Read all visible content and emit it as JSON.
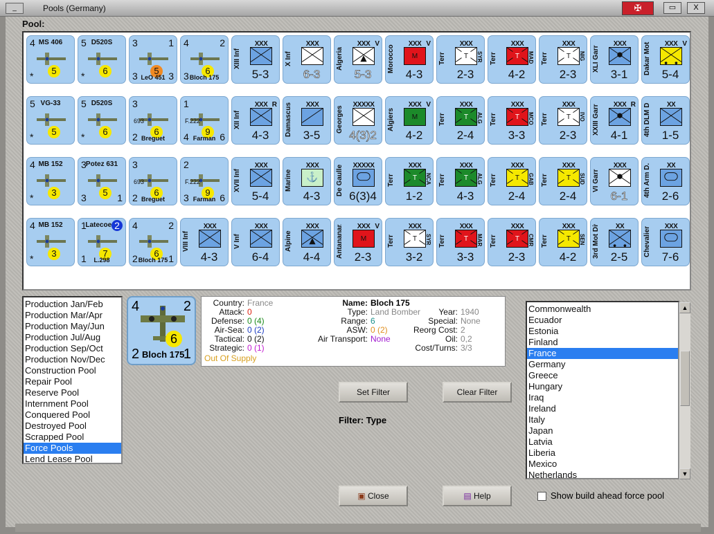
{
  "window": {
    "title": "Pools (Germany)",
    "minimize": "_",
    "close": "X",
    "restore": "▭",
    "flag": "✠"
  },
  "pool_label": "Pool:",
  "counters": [
    {
      "kind": "air",
      "tl": "4",
      "name": "MS 406",
      "circ": "5",
      "bl": "*",
      "col": 0,
      "row": 0
    },
    {
      "kind": "air",
      "tl": "5",
      "name": "D520S",
      "circ": "6",
      "bl": "*",
      "col": 1,
      "row": 0
    },
    {
      "kind": "air",
      "tl": "3",
      "tr": "1",
      "circ": "5",
      "circClass": "orange",
      "bl": "3",
      "br": "3",
      "sub": "LeO 451",
      "col": 2,
      "row": 0
    },
    {
      "kind": "air",
      "tl": "4",
      "tr": "2",
      "circ": "6",
      "bl": "3",
      "br": "",
      "sub": "Bloch 175",
      "col": 3,
      "row": 0
    },
    {
      "kind": "land",
      "label": "XIII Inf",
      "size": "XXX",
      "stat": "5-3",
      "col": 4,
      "row": 0,
      "sym": "inf"
    },
    {
      "kind": "land",
      "label": "X Inf",
      "size": "XXX",
      "stat": "6-3",
      "col": 5,
      "row": 0,
      "sym": "inf",
      "white": true
    },
    {
      "kind": "land",
      "label": "Algeria",
      "size": "XXX",
      "stat": "5-3",
      "col": 6,
      "row": 0,
      "sym": "mtn",
      "white": true,
      "vmark": "V"
    },
    {
      "kind": "land",
      "label": "Morocco",
      "size": "XXX",
      "stat": "4-3",
      "col": 7,
      "row": 0,
      "sym": "M",
      "bg": "#e0141b",
      "vmark": "V"
    },
    {
      "kind": "land",
      "label": "Terr",
      "size": "XXX",
      "stat": "2-3",
      "col": 8,
      "row": 0,
      "sym": "T",
      "bg": "#ffffff",
      "rot": "SYR"
    },
    {
      "kind": "land",
      "label": "Terr",
      "size": "XXX",
      "stat": "4-2",
      "col": 9,
      "row": 0,
      "sym": "T",
      "bg": "#e0141b",
      "rot": "MAD"
    },
    {
      "kind": "land",
      "label": "Terr",
      "size": "XXX",
      "stat": "2-3",
      "col": 10,
      "row": 0,
      "sym": "T",
      "bg": "#ffffff",
      "rot": "NIG"
    },
    {
      "kind": "land",
      "label": "XLI Garr",
      "size": "XXX",
      "stat": "3-1",
      "col": 11,
      "row": 0,
      "sym": "garr"
    },
    {
      "kind": "land",
      "label": "Dakar Mot",
      "size": "XXX",
      "stat": "5-4",
      "col": 12,
      "row": 0,
      "sym": "mot",
      "bg": "#f5e800",
      "vmark": "V"
    },
    {
      "kind": "air",
      "tl": "5",
      "name": "VG-33",
      "circ": "5",
      "bl": "*",
      "col": 0,
      "row": 1
    },
    {
      "kind": "air",
      "tl": "5",
      "name": "D520S",
      "circ": "6",
      "bl": "*",
      "col": 1,
      "row": 1
    },
    {
      "kind": "air",
      "tl": "3",
      "circ": "6",
      "bl": "2",
      "sub": "Breguet",
      "mid": "693",
      "col": 2,
      "row": 1
    },
    {
      "kind": "air",
      "tl": "1",
      "circ": "9",
      "bl": "4",
      "br": "6",
      "sub": "Farman",
      "mid": "F.222",
      "col": 3,
      "row": 1
    },
    {
      "kind": "land",
      "label": "XII Inf",
      "size": "XXX",
      "stat": "4-3",
      "col": 4,
      "row": 1,
      "sym": "inf",
      "vmark": "R"
    },
    {
      "kind": "land",
      "label": "Damascus",
      "size": "XXX",
      "stat": "3-5",
      "col": 5,
      "row": 1,
      "sym": "mtn2"
    },
    {
      "kind": "land",
      "label": "Georges",
      "size": "XXXXX",
      "stat": "4(3)2",
      "col": 6,
      "row": 1,
      "sym": "inf",
      "white": true
    },
    {
      "kind": "land",
      "label": "Algiers",
      "size": "XXX",
      "stat": "4-2",
      "col": 7,
      "row": 1,
      "sym": "M",
      "bg": "#1c8a2a",
      "vmark": "V"
    },
    {
      "kind": "land",
      "label": "Terr",
      "size": "XXX",
      "stat": "2-4",
      "col": 8,
      "row": 1,
      "sym": "T",
      "bg": "#1c8a2a",
      "rot": "ALG"
    },
    {
      "kind": "land",
      "label": "Terr",
      "size": "XXX",
      "stat": "3-3",
      "col": 9,
      "row": 1,
      "sym": "T",
      "bg": "#e0141b",
      "rot": "MCO"
    },
    {
      "kind": "land",
      "label": "Terr",
      "size": "XXX",
      "stat": "2-3",
      "col": 10,
      "row": 1,
      "sym": "T",
      "bg": "#ffffff",
      "rot": "IVO"
    },
    {
      "kind": "land",
      "label": "XXIII Garr",
      "size": "XXX",
      "stat": "4-1",
      "col": 11,
      "row": 1,
      "sym": "garr",
      "vmark": "R"
    },
    {
      "kind": "land",
      "label": "4th DLM D.",
      "size": "XX",
      "stat": "1-5",
      "col": 12,
      "row": 1,
      "sym": "inf"
    },
    {
      "kind": "air",
      "tl": "4",
      "name": "MB 152",
      "circ": "3",
      "bl": "*",
      "col": 0,
      "row": 2
    },
    {
      "kind": "air",
      "tl": "3",
      "name": "Potez 631",
      "circ": "5",
      "bl": "3",
      "br": "1",
      "col": 1,
      "row": 2
    },
    {
      "kind": "air",
      "tl": "3",
      "circ": "6",
      "bl": "2",
      "sub": "Breguet",
      "mid": "693",
      "col": 2,
      "row": 2
    },
    {
      "kind": "air",
      "tl": "2",
      "circ": "9",
      "bl": "3",
      "br": "6",
      "sub": "Farman",
      "mid": "F.222",
      "col": 3,
      "row": 2
    },
    {
      "kind": "land",
      "label": "XVII Inf",
      "size": "XXX",
      "stat": "5-4",
      "col": 4,
      "row": 2,
      "sym": "inf"
    },
    {
      "kind": "land",
      "label": "Marine",
      "size": "XXX",
      "stat": "4-3",
      "col": 5,
      "row": 2,
      "sym": "anchor",
      "bg": "#c9f0c9"
    },
    {
      "kind": "land",
      "label": "De Gaulle",
      "size": "XXXXX",
      "stat": "6(3)4",
      "col": 6,
      "row": 2,
      "sym": "arm"
    },
    {
      "kind": "land",
      "label": "Terr",
      "size": "XXX",
      "stat": "1-2",
      "col": 7,
      "row": 2,
      "sym": "T",
      "bg": "#1c8a2a",
      "rot": "NCA"
    },
    {
      "kind": "land",
      "label": "Terr",
      "size": "XXX",
      "stat": "4-3",
      "col": 8,
      "row": 2,
      "sym": "T",
      "bg": "#1c8a2a",
      "rot": "ALG"
    },
    {
      "kind": "land",
      "label": "Terr",
      "size": "XXX",
      "stat": "2-4",
      "col": 9,
      "row": 2,
      "sym": "T",
      "bg": "#f5e800",
      "rot": "GAB"
    },
    {
      "kind": "land",
      "label": "Terr",
      "size": "XXX",
      "stat": "2-4",
      "col": 10,
      "row": 2,
      "sym": "T",
      "bg": "#f5e800",
      "rot": "SUD"
    },
    {
      "kind": "land",
      "label": "VI Garr",
      "size": "XXX",
      "stat": "6-1",
      "col": 11,
      "row": 2,
      "sym": "garr",
      "white": true
    },
    {
      "kind": "land",
      "label": "4th Arm D.",
      "size": "XX",
      "stat": "2-6",
      "col": 12,
      "row": 2,
      "sym": "arm"
    },
    {
      "kind": "air",
      "tl": "4",
      "name": "MB 152",
      "circ": "3",
      "bl": "*",
      "col": 0,
      "row": 3
    },
    {
      "kind": "air",
      "tl": "1",
      "name": "Latecoere",
      "circ": "7",
      "bl": "1",
      "sub": "L.298",
      "tr": "2",
      "trBlue": true,
      "col": 1,
      "row": 3
    },
    {
      "kind": "air",
      "tl": "4",
      "tr": "2",
      "circ": "6",
      "bl": "2",
      "br": "1",
      "sub": "Bloch 175",
      "col": 2,
      "row": 3
    },
    {
      "kind": "land",
      "label": "VIII Inf",
      "size": "XXX",
      "stat": "4-3",
      "col": 3,
      "row": 3,
      "sym": "inf"
    },
    {
      "kind": "land",
      "label": "V Inf",
      "size": "XXX",
      "stat": "6-4",
      "col": 4,
      "row": 3,
      "sym": "inf"
    },
    {
      "kind": "land",
      "label": "Alpine",
      "size": "XXX",
      "stat": "4-4",
      "col": 5,
      "row": 3,
      "sym": "mtn"
    },
    {
      "kind": "land",
      "label": "Antananar.",
      "size": "XXX",
      "stat": "2-3",
      "col": 6,
      "row": 3,
      "sym": "M",
      "bg": "#e0141b",
      "vmark": "V"
    },
    {
      "kind": "land",
      "label": "Terr",
      "size": "XXX",
      "stat": "3-2",
      "col": 7,
      "row": 3,
      "sym": "T",
      "bg": "#ffffff",
      "rot": "SYR"
    },
    {
      "kind": "land",
      "label": "Terr",
      "size": "XXX",
      "stat": "3-3",
      "col": 8,
      "row": 3,
      "sym": "T",
      "bg": "#e0141b",
      "rot": "MAR"
    },
    {
      "kind": "land",
      "label": "Terr",
      "size": "XXX",
      "stat": "2-3",
      "col": 9,
      "row": 3,
      "sym": "T",
      "bg": "#e0141b",
      "rot": "CMR"
    },
    {
      "kind": "land",
      "label": "Terr",
      "size": "XXX",
      "stat": "4-2",
      "col": 10,
      "row": 3,
      "sym": "T",
      "bg": "#f5e800",
      "rot": "SEN"
    },
    {
      "kind": "land",
      "label": "3rd Mot Div",
      "size": "XX",
      "stat": "2-5",
      "col": 11,
      "row": 3,
      "sym": "mot"
    },
    {
      "kind": "land",
      "label": "Chevalier",
      "size": "XXX",
      "stat": "7-6",
      "col": 12,
      "row": 3,
      "sym": "arm"
    }
  ],
  "pool_list": {
    "items": [
      "Production Jan/Feb",
      "Production Mar/Apr",
      "Production May/Jun",
      "Production Jul/Aug",
      "Production Sep/Oct",
      "Production Nov/Dec",
      "Construction Pool",
      "Repair Pool",
      "Reserve Pool",
      "Internment Pool",
      "Conquered Pool",
      "Destroyed Pool",
      "Scrapped Pool",
      "Force Pools",
      "Lend Lease Pool"
    ],
    "selected": "Force Pools"
  },
  "preview": {
    "tl": "4",
    "tr": "2",
    "bl": "2",
    "br": "1",
    "circ": "6",
    "sub": "Bloch 175"
  },
  "info": {
    "country_label": "Country:",
    "country": "France",
    "attack_label": "Attack:",
    "attack": "0",
    "defense_label": "Defense:",
    "defense": "0 (4)",
    "airsea_label": "Air-Sea:",
    "airsea": "0 (2)",
    "tactical_label": "Tactical:",
    "tactical": "0 (2)",
    "strategic_label": "Strategic:",
    "strategic": "0 (1)",
    "supply": "Out Of Supply",
    "name_label": "Name:",
    "name": "Bloch 175",
    "type_label": "Type:",
    "type": "Land Bomber",
    "year_label": "Year:",
    "year": "1940",
    "range_label": "Range:",
    "range": "6",
    "special_label": "Special:",
    "special": "None",
    "asw_label": "ASW:",
    "asw": "0 (2)",
    "reorg_label": "Reorg Cost:",
    "reorg": "2",
    "airtransport_label": "Air Transport:",
    "airtransport": "None",
    "oil_label": "Oil:",
    "oil": "0,2",
    "cost_label": "Cost/Turns:",
    "cost": "3/3"
  },
  "buttons": {
    "set_filter": "Set Filter",
    "clear_filter": "Clear Filter",
    "close": "Close",
    "help": "Help"
  },
  "filter_text": "Filter: Type",
  "country_list": {
    "items": [
      "Commonwealth",
      "Ecuador",
      "Estonia",
      "Finland",
      "France",
      "Germany",
      "Greece",
      "Hungary",
      "Iraq",
      "Ireland",
      "Italy",
      "Japan",
      "Latvia",
      "Liberia",
      "Mexico",
      "Netherlands"
    ],
    "selected": "France"
  },
  "checkbox": {
    "label": "Show build ahead force pool",
    "checked": false
  },
  "colors": {
    "counter_bg": "#a7cdf0",
    "selection": "#2a7ef0",
    "circle": "#f6e800"
  }
}
